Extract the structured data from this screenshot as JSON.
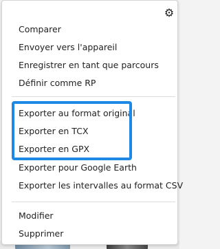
{
  "menu": {
    "gear_icon": "gear-icon",
    "group1": [
      "Comparer",
      "Envoyer vers l'appareil",
      "Enregistrer en tant que parcours",
      "Définir comme RP"
    ],
    "group2": [
      "Exporter au format original",
      "Exporter en TCX",
      "Exporter en GPX",
      "Exporter pour Google Earth",
      "Exporter les intervalles au format CSV"
    ],
    "group3": [
      "Modifier",
      "Supprimer"
    ]
  },
  "colors": {
    "highlight": "#1e88e5",
    "text": "#222222"
  }
}
